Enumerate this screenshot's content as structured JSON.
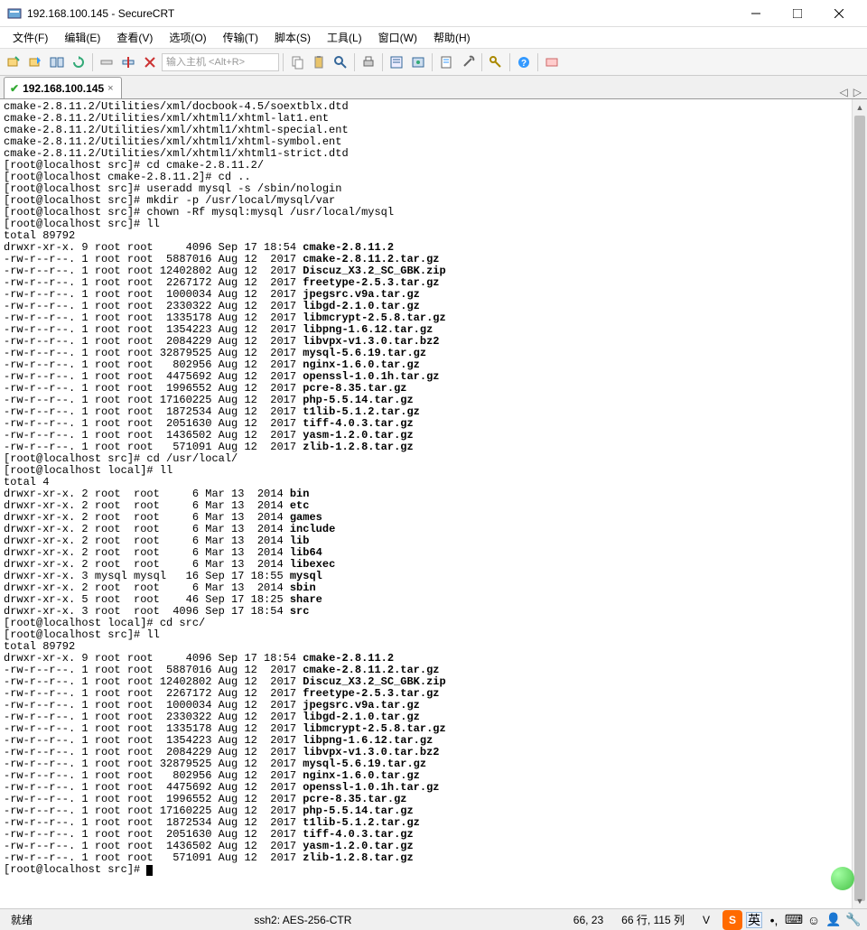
{
  "window": {
    "title": "192.168.100.145 - SecureCRT"
  },
  "menu": {
    "file": "文件(F)",
    "edit": "编辑(E)",
    "view": "查看(V)",
    "options": "选项(O)",
    "transfer": "传输(T)",
    "script": "脚本(S)",
    "tools": "工具(L)",
    "window": "窗口(W)",
    "help": "帮助(H)"
  },
  "toolbar": {
    "host_placeholder": "输入主机 <Alt+R>"
  },
  "tab": {
    "name": "192.168.100.145",
    "close": "×"
  },
  "tabnav": {
    "left": "◁",
    "right": "▷"
  },
  "status": {
    "ready": "就绪",
    "cipher": "ssh2: AES-256-CTR",
    "pos": "66, 23",
    "size": "66 行, 115 列",
    "vt": "V",
    "ime": "英"
  },
  "term": {
    "lines": [
      {
        "pre": "cmake-2.8.11.2/Utilities/xml/docbook-4.5/soextblx.dtd"
      },
      {
        "pre": "cmake-2.8.11.2/Utilities/xml/xhtml1/xhtml-lat1.ent"
      },
      {
        "pre": "cmake-2.8.11.2/Utilities/xml/xhtml1/xhtml-special.ent"
      },
      {
        "pre": "cmake-2.8.11.2/Utilities/xml/xhtml1/xhtml-symbol.ent"
      },
      {
        "pre": "cmake-2.8.11.2/Utilities/xml/xhtml1/xhtml1-strict.dtd"
      },
      {
        "pre": "[root@localhost src]# cd cmake-2.8.11.2/"
      },
      {
        "pre": "[root@localhost cmake-2.8.11.2]# cd .."
      },
      {
        "pre": "[root@localhost src]# useradd mysql -s /sbin/nologin"
      },
      {
        "pre": "[root@localhost src]# mkdir -p /usr/local/mysql/var"
      },
      {
        "pre": "[root@localhost src]# chown -Rf mysql:mysql /usr/local/mysql"
      },
      {
        "pre": "[root@localhost src]# ll"
      },
      {
        "pre": "total 89792"
      },
      {
        "pre": "drwxr-xr-x. 9 root root     4096 Sep 17 18:54 ",
        "b": "cmake-2.8.11.2"
      },
      {
        "pre": "-rw-r--r--. 1 root root  5887016 Aug 12  2017 ",
        "b": "cmake-2.8.11.2.tar.gz"
      },
      {
        "pre": "-rw-r--r--. 1 root root 12402802 Aug 12  2017 ",
        "b": "Discuz_X3.2_SC_GBK.zip"
      },
      {
        "pre": "-rw-r--r--. 1 root root  2267172 Aug 12  2017 ",
        "b": "freetype-2.5.3.tar.gz"
      },
      {
        "pre": "-rw-r--r--. 1 root root  1000034 Aug 12  2017 ",
        "b": "jpegsrc.v9a.tar.gz"
      },
      {
        "pre": "-rw-r--r--. 1 root root  2330322 Aug 12  2017 ",
        "b": "libgd-2.1.0.tar.gz"
      },
      {
        "pre": "-rw-r--r--. 1 root root  1335178 Aug 12  2017 ",
        "b": "libmcrypt-2.5.8.tar.gz"
      },
      {
        "pre": "-rw-r--r--. 1 root root  1354223 Aug 12  2017 ",
        "b": "libpng-1.6.12.tar.gz"
      },
      {
        "pre": "-rw-r--r--. 1 root root  2084229 Aug 12  2017 ",
        "b": "libvpx-v1.3.0.tar.bz2"
      },
      {
        "pre": "-rw-r--r--. 1 root root 32879525 Aug 12  2017 ",
        "b": "mysql-5.6.19.tar.gz"
      },
      {
        "pre": "-rw-r--r--. 1 root root   802956 Aug 12  2017 ",
        "b": "nginx-1.6.0.tar.gz"
      },
      {
        "pre": "-rw-r--r--. 1 root root  4475692 Aug 12  2017 ",
        "b": "openssl-1.0.1h.tar.gz"
      },
      {
        "pre": "-rw-r--r--. 1 root root  1996552 Aug 12  2017 ",
        "b": "pcre-8.35.tar.gz"
      },
      {
        "pre": "-rw-r--r--. 1 root root 17160225 Aug 12  2017 ",
        "b": "php-5.5.14.tar.gz"
      },
      {
        "pre": "-rw-r--r--. 1 root root  1872534 Aug 12  2017 ",
        "b": "t1lib-5.1.2.tar.gz"
      },
      {
        "pre": "-rw-r--r--. 1 root root  2051630 Aug 12  2017 ",
        "b": "tiff-4.0.3.tar.gz"
      },
      {
        "pre": "-rw-r--r--. 1 root root  1436502 Aug 12  2017 ",
        "b": "yasm-1.2.0.tar.gz"
      },
      {
        "pre": "-rw-r--r--. 1 root root   571091 Aug 12  2017 ",
        "b": "zlib-1.2.8.tar.gz"
      },
      {
        "pre": "[root@localhost src]# cd /usr/local/"
      },
      {
        "pre": "[root@localhost local]# ll"
      },
      {
        "pre": "total 4"
      },
      {
        "pre": "drwxr-xr-x. 2 root  root     6 Mar 13  2014 ",
        "b": "bin"
      },
      {
        "pre": "drwxr-xr-x. 2 root  root     6 Mar 13  2014 ",
        "b": "etc"
      },
      {
        "pre": "drwxr-xr-x. 2 root  root     6 Mar 13  2014 ",
        "b": "games"
      },
      {
        "pre": "drwxr-xr-x. 2 root  root     6 Mar 13  2014 ",
        "b": "include"
      },
      {
        "pre": "drwxr-xr-x. 2 root  root     6 Mar 13  2014 ",
        "b": "lib"
      },
      {
        "pre": "drwxr-xr-x. 2 root  root     6 Mar 13  2014 ",
        "b": "lib64"
      },
      {
        "pre": "drwxr-xr-x. 2 root  root     6 Mar 13  2014 ",
        "b": "libexec"
      },
      {
        "pre": "drwxr-xr-x. 3 mysql mysql   16 Sep 17 18:55 ",
        "b": "mysql"
      },
      {
        "pre": "drwxr-xr-x. 2 root  root     6 Mar 13  2014 ",
        "b": "sbin"
      },
      {
        "pre": "drwxr-xr-x. 5 root  root    46 Sep 17 18:25 ",
        "b": "share"
      },
      {
        "pre": "drwxr-xr-x. 3 root  root  4096 Sep 17 18:54 ",
        "b": "src"
      },
      {
        "pre": "[root@localhost local]# cd src/"
      },
      {
        "pre": "[root@localhost src]# ll"
      },
      {
        "pre": "total 89792"
      },
      {
        "pre": "drwxr-xr-x. 9 root root     4096 Sep 17 18:54 ",
        "b": "cmake-2.8.11.2"
      },
      {
        "pre": "-rw-r--r--. 1 root root  5887016 Aug 12  2017 ",
        "b": "cmake-2.8.11.2.tar.gz"
      },
      {
        "pre": "-rw-r--r--. 1 root root 12402802 Aug 12  2017 ",
        "b": "Discuz_X3.2_SC_GBK.zip"
      },
      {
        "pre": "-rw-r--r--. 1 root root  2267172 Aug 12  2017 ",
        "b": "freetype-2.5.3.tar.gz"
      },
      {
        "pre": "-rw-r--r--. 1 root root  1000034 Aug 12  2017 ",
        "b": "jpegsrc.v9a.tar.gz"
      },
      {
        "pre": "-rw-r--r--. 1 root root  2330322 Aug 12  2017 ",
        "b": "libgd-2.1.0.tar.gz"
      },
      {
        "pre": "-rw-r--r--. 1 root root  1335178 Aug 12  2017 ",
        "b": "libmcrypt-2.5.8.tar.gz"
      },
      {
        "pre": "-rw-r--r--. 1 root root  1354223 Aug 12  2017 ",
        "b": "libpng-1.6.12.tar.gz"
      },
      {
        "pre": "-rw-r--r--. 1 root root  2084229 Aug 12  2017 ",
        "b": "libvpx-v1.3.0.tar.bz2"
      },
      {
        "pre": "-rw-r--r--. 1 root root 32879525 Aug 12  2017 ",
        "b": "mysql-5.6.19.tar.gz"
      },
      {
        "pre": "-rw-r--r--. 1 root root   802956 Aug 12  2017 ",
        "b": "nginx-1.6.0.tar.gz"
      },
      {
        "pre": "-rw-r--r--. 1 root root  4475692 Aug 12  2017 ",
        "b": "openssl-1.0.1h.tar.gz"
      },
      {
        "pre": "-rw-r--r--. 1 root root  1996552 Aug 12  2017 ",
        "b": "pcre-8.35.tar.gz"
      },
      {
        "pre": "-rw-r--r--. 1 root root 17160225 Aug 12  2017 ",
        "b": "php-5.5.14.tar.gz"
      },
      {
        "pre": "-rw-r--r--. 1 root root  1872534 Aug 12  2017 ",
        "b": "t1lib-5.1.2.tar.gz"
      },
      {
        "pre": "-rw-r--r--. 1 root root  2051630 Aug 12  2017 ",
        "b": "tiff-4.0.3.tar.gz"
      },
      {
        "pre": "-rw-r--r--. 1 root root  1436502 Aug 12  2017 ",
        "b": "yasm-1.2.0.tar.gz"
      },
      {
        "pre": "-rw-r--r--. 1 root root   571091 Aug 12  2017 ",
        "b": "zlib-1.2.8.tar.gz"
      },
      {
        "pre": "[root@localhost src]# ",
        "cursor": true
      }
    ]
  }
}
